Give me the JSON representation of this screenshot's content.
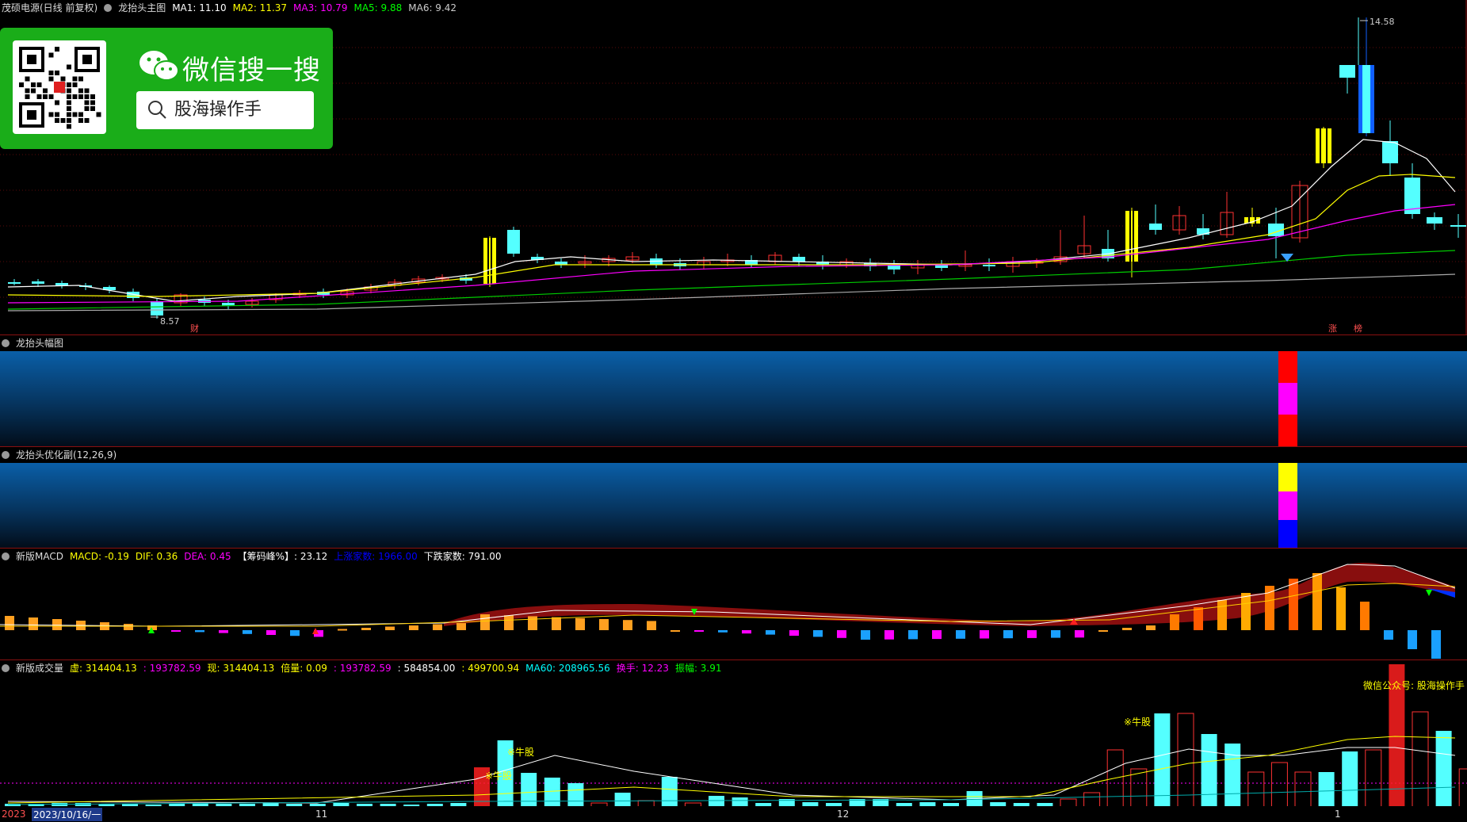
{
  "main": {
    "stock_name": "茂硕电源(日线 前复权)",
    "indicator_name": "龙抬头主图",
    "ma1": "MA1: 11.10",
    "ma2": "MA2: 11.37",
    "ma3": "MA3: 10.79",
    "ma5": "MA5: 9.88",
    "ma6": "MA6: 9.42",
    "high_label": "14.58",
    "low_label": "8.57",
    "marker_cai": "财",
    "marker_zhang": "涨",
    "marker_bang": "榜"
  },
  "wechat": {
    "title": "微信搜一搜",
    "search_text": "股海操作手"
  },
  "panel2": {
    "title": "龙抬头幅图"
  },
  "panel3": {
    "title": "龙抬头优化副",
    "params": "(12,26,9)"
  },
  "macd": {
    "title": "新版MACD",
    "macd": "MACD: -0.19",
    "dif": "DIF: 0.36",
    "dea": "DEA: 0.45",
    "chip": "【筹码峰%】: 23.12",
    "up_count": "上涨家数: 1966.00",
    "down_count": "下跌家数: 791.00"
  },
  "volume": {
    "title": "新版成交量",
    "vol1": "虚: 314404.13",
    "vol2": ": 193782.59",
    "now": "现: 314404.13",
    "ratio": "倍量: 0.09",
    "vol3": ": 193782.59",
    "v4": ": 584854.00",
    "v5": ": 499700.94",
    "ma60": "MA60: 208965.56",
    "turnover": "换手: 12.23",
    "amplitude": "振幅: 3.91",
    "wechat_note": "微信公众号: 股海操作手",
    "bull1": "※牛股",
    "bull2": "※牛股",
    "bull3": "※牛股"
  },
  "axis": {
    "start_year": "2023",
    "start_date": "2023/10/16/一",
    "m11": "11",
    "m12": "12",
    "m1": "1"
  },
  "colors": {
    "up": "#ff3232",
    "down": "#54ffff",
    "yellow": "#ffff00",
    "magenta": "#ff00ff",
    "blue": "#0000ff",
    "grid": "#8a1010"
  }
}
